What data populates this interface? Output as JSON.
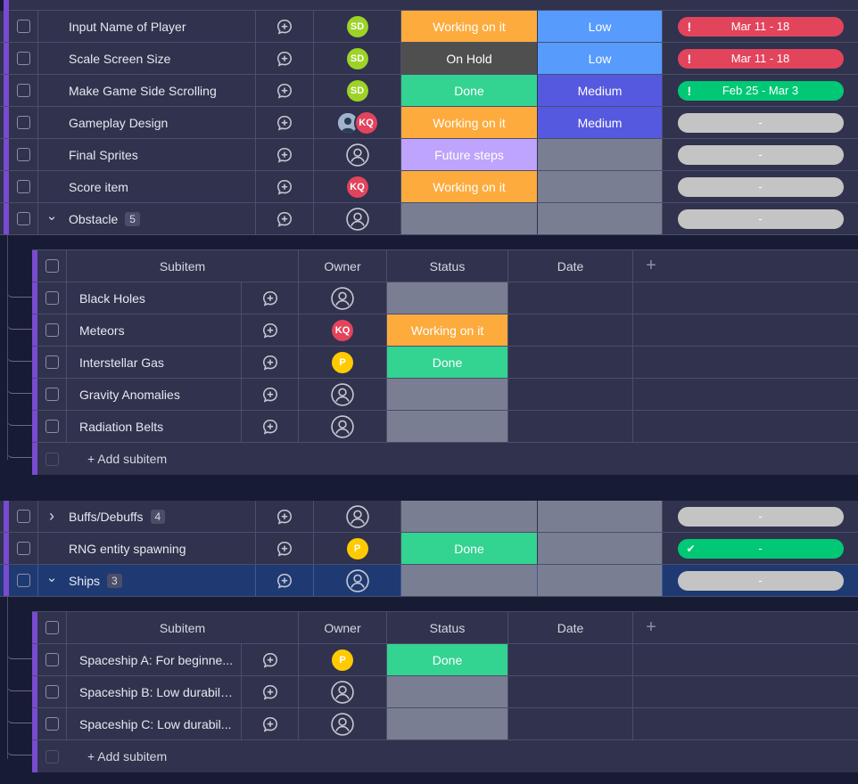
{
  "colors": {
    "working": "#fdab3d",
    "hold": "#4f4f4f",
    "done": "#33d391",
    "future": "#bea4fc",
    "empty": "#797e93",
    "low": "#579bfc",
    "medium": "#5559df",
    "red": "#e2445c",
    "green": "#00c875",
    "grey_pill": "#c4c4c4",
    "av_sd": "#9cd326",
    "av_kq": "#e2445c",
    "av_p": "#ffcb00"
  },
  "items": [
    {
      "name": "Input Name of Player",
      "owner": {
        "type": "initials",
        "text": "SD",
        "color": "av_sd"
      },
      "status": "Working on it",
      "status_color": "working",
      "priority": "Low",
      "priority_color": "low",
      "timeline": "Mar 11 - 18",
      "timeline_color": "red",
      "marker": "!"
    },
    {
      "name": "Scale Screen Size",
      "owner": {
        "type": "initials",
        "text": "SD",
        "color": "av_sd"
      },
      "status": "On Hold",
      "status_color": "hold",
      "priority": "Low",
      "priority_color": "low",
      "timeline": "Mar 11 - 18",
      "timeline_color": "red",
      "marker": "!"
    },
    {
      "name": "Make Game Side Scrolling",
      "owner": {
        "type": "initials",
        "text": "SD",
        "color": "av_sd"
      },
      "status": "Done",
      "status_color": "done",
      "priority": "Medium",
      "priority_color": "medium",
      "timeline": "Feb 25 - Mar 3",
      "timeline_color": "green",
      "marker": "!"
    },
    {
      "name": "Gameplay Design",
      "owner": {
        "type": "pair",
        "text": "KQ",
        "color": "av_kq"
      },
      "status": "Working on it",
      "status_color": "working",
      "priority": "Medium",
      "priority_color": "medium",
      "timeline": "-",
      "timeline_color": "grey_pill",
      "marker": ""
    },
    {
      "name": "Final Sprites",
      "owner": {
        "type": "empty"
      },
      "status": "Future steps",
      "status_color": "future",
      "priority": "",
      "priority_color": "empty",
      "timeline": "-",
      "timeline_color": "grey_pill",
      "marker": ""
    },
    {
      "name": "Score item",
      "owner": {
        "type": "initials",
        "text": "KQ",
        "color": "av_kq"
      },
      "status": "Working on it",
      "status_color": "working",
      "priority": "",
      "priority_color": "empty",
      "timeline": "-",
      "timeline_color": "grey_pill",
      "marker": ""
    },
    {
      "name": "Obstacle",
      "count": "5",
      "expand": "open",
      "owner": {
        "type": "empty"
      },
      "status": "",
      "status_color": "empty",
      "priority": "",
      "priority_color": "empty",
      "timeline": "-",
      "timeline_color": "grey_pill",
      "marker": ""
    }
  ],
  "items2": [
    {
      "name": "Buffs/Debuffs",
      "count": "4",
      "expand": "closed",
      "owner": {
        "type": "empty"
      },
      "status": "",
      "status_color": "empty",
      "priority": "",
      "priority_color": "empty",
      "timeline": "-",
      "timeline_color": "grey_pill",
      "marker": ""
    },
    {
      "name": "RNG entity spawning",
      "owner": {
        "type": "initials",
        "text": "P",
        "color": "av_p"
      },
      "status": "Done",
      "status_color": "done",
      "priority": "",
      "priority_color": "empty",
      "timeline": "-",
      "timeline_color": "green",
      "marker": "✔"
    },
    {
      "name": "Ships",
      "count": "3",
      "expand": "open",
      "selected": true,
      "owner": {
        "type": "empty"
      },
      "status": "",
      "status_color": "empty",
      "priority": "",
      "priority_color": "empty",
      "timeline": "-",
      "timeline_color": "grey_pill",
      "marker": ""
    }
  ],
  "subheader": {
    "subitem": "Subitem",
    "owner": "Owner",
    "status": "Status",
    "date": "Date",
    "add": "+"
  },
  "subitems_obstacle": [
    {
      "name": "Black Holes",
      "owner": {
        "type": "empty"
      },
      "status": "",
      "status_color": "empty"
    },
    {
      "name": "Meteors",
      "owner": {
        "type": "initials",
        "text": "KQ",
        "color": "av_kq"
      },
      "status": "Working on it",
      "status_color": "working"
    },
    {
      "name": "Interstellar Gas",
      "owner": {
        "type": "initials",
        "text": "P",
        "color": "av_p"
      },
      "status": "Done",
      "status_color": "done"
    },
    {
      "name": "Gravity Anomalies",
      "owner": {
        "type": "empty"
      },
      "status": "",
      "status_color": "empty"
    },
    {
      "name": "Radiation Belts",
      "owner": {
        "type": "empty"
      },
      "status": "",
      "status_color": "empty"
    }
  ],
  "subitems_ships": [
    {
      "name": "Spaceship A: For beginne...",
      "owner": {
        "type": "initials",
        "text": "P",
        "color": "av_p"
      },
      "status": "Done",
      "status_color": "done"
    },
    {
      "name": "Spaceship B: Low durabili...",
      "owner": {
        "type": "empty"
      },
      "status": "",
      "status_color": "empty"
    },
    {
      "name": "Spaceship C: Low durabil...",
      "owner": {
        "type": "empty"
      },
      "status": "",
      "status_color": "empty"
    }
  ],
  "add_subitem": "+ Add subitem"
}
